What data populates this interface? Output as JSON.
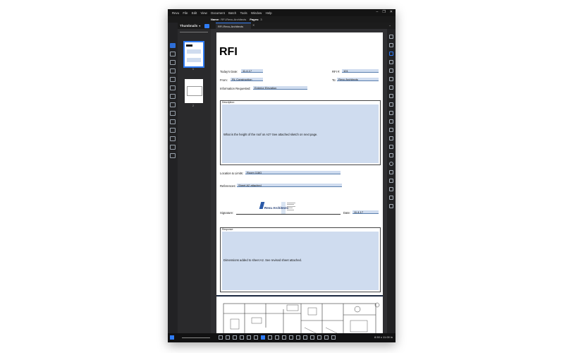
{
  "menu": [
    "Revu",
    "File",
    "Edit",
    "View",
    "Document",
    "Batch",
    "Tools",
    "Window",
    "Help"
  ],
  "info": {
    "name_label": "Name:",
    "name_value": "RFI-Revu-Architects",
    "pages_label": "Pages:",
    "pages_value": "3"
  },
  "thumbnails": {
    "title": "Thumbnails",
    "pages": [
      "1",
      "2"
    ]
  },
  "tab": {
    "label": "RFI-Revu-Architects"
  },
  "rfi": {
    "title": "RFI",
    "todays_date_label": "Today's Date:",
    "todays_date_value": "11.4.17",
    "rfi_no_label": "RFI #:",
    "rfi_no_value": "101",
    "from_label": "From:",
    "from_value": "RL Construction",
    "to_label": "To:",
    "to_value": "Revu Architects",
    "info_req_label": "Information Requested:",
    "info_req_value": "Exterior Elevation",
    "description_label": "Description:",
    "description_text": "What is the height of the roof on A2? See attached sketch on next page.",
    "location_label": "Location & Limits:",
    "location_value": "Room 118G",
    "references_label": "References:",
    "references_value": "Sheet A2 attached",
    "logo_text": "Revu Architects",
    "signature_label": "Signature:",
    "date_label": "Date:",
    "date_value": "11.4.17",
    "response_label": "Response:",
    "response_text": "Dimensions added to sheet A2. See revised sheet attached."
  },
  "status": {
    "page_size": "8.50 x 11.00 in"
  },
  "colors": {
    "field_fill": "#cfdcef",
    "accent": "#2f7cf6",
    "app_bg": "#1d1d1f"
  }
}
